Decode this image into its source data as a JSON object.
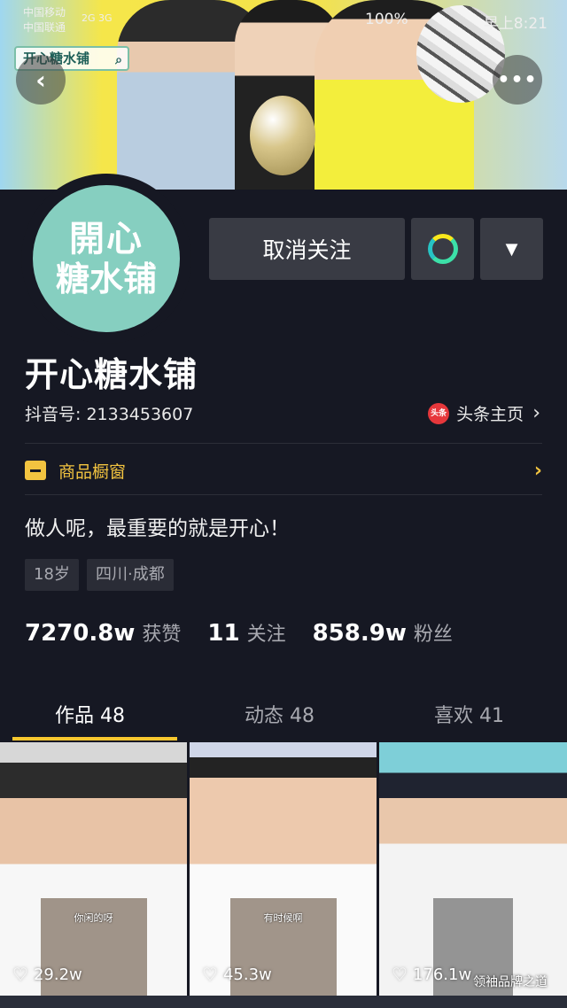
{
  "status_bar": {
    "carrier1": "中国移动",
    "carrier2": "中国联通",
    "signal": "2G 3G",
    "battery": "100%",
    "time": "早上8:21"
  },
  "banner": {
    "badge_text": "开心糖水铺"
  },
  "avatar": {
    "line1": "開心",
    "line2": "糖水铺",
    "bg_color": "#86cfc0"
  },
  "actions": {
    "unfollow_label": "取消关注",
    "chat_icon": "chat-bubble-icon",
    "dropdown_icon": "triangle-down-icon"
  },
  "profile": {
    "name": "开心糖水铺",
    "douyin_id": "抖音号: 2133453607",
    "toutiao_logo": "头条",
    "toutiao_label": "头条主页",
    "shop_label": "商品橱窗",
    "bio": "做人呢，最重要的就是开心！",
    "tags": [
      "18岁",
      "四川·成都"
    ]
  },
  "stats": [
    {
      "num": "7270.8w",
      "label": "获赞"
    },
    {
      "num": "11",
      "label": "关注"
    },
    {
      "num": "858.9w",
      "label": "粉丝"
    }
  ],
  "tabs": [
    {
      "label": "作品 48",
      "active": true
    },
    {
      "label": "动态 48",
      "active": false
    },
    {
      "label": "喜欢 41",
      "active": false
    }
  ],
  "videos": [
    {
      "likes": "29.2w",
      "caption": "你闲的呀"
    },
    {
      "likes": "45.3w",
      "caption": "有时候啊"
    },
    {
      "likes": "176.1w",
      "caption": ""
    }
  ],
  "watermark": "领袖品牌之道",
  "colors": {
    "background": "#161823",
    "accent": "#f8c72e",
    "button": "#393b44",
    "shop": "#f3c440"
  }
}
